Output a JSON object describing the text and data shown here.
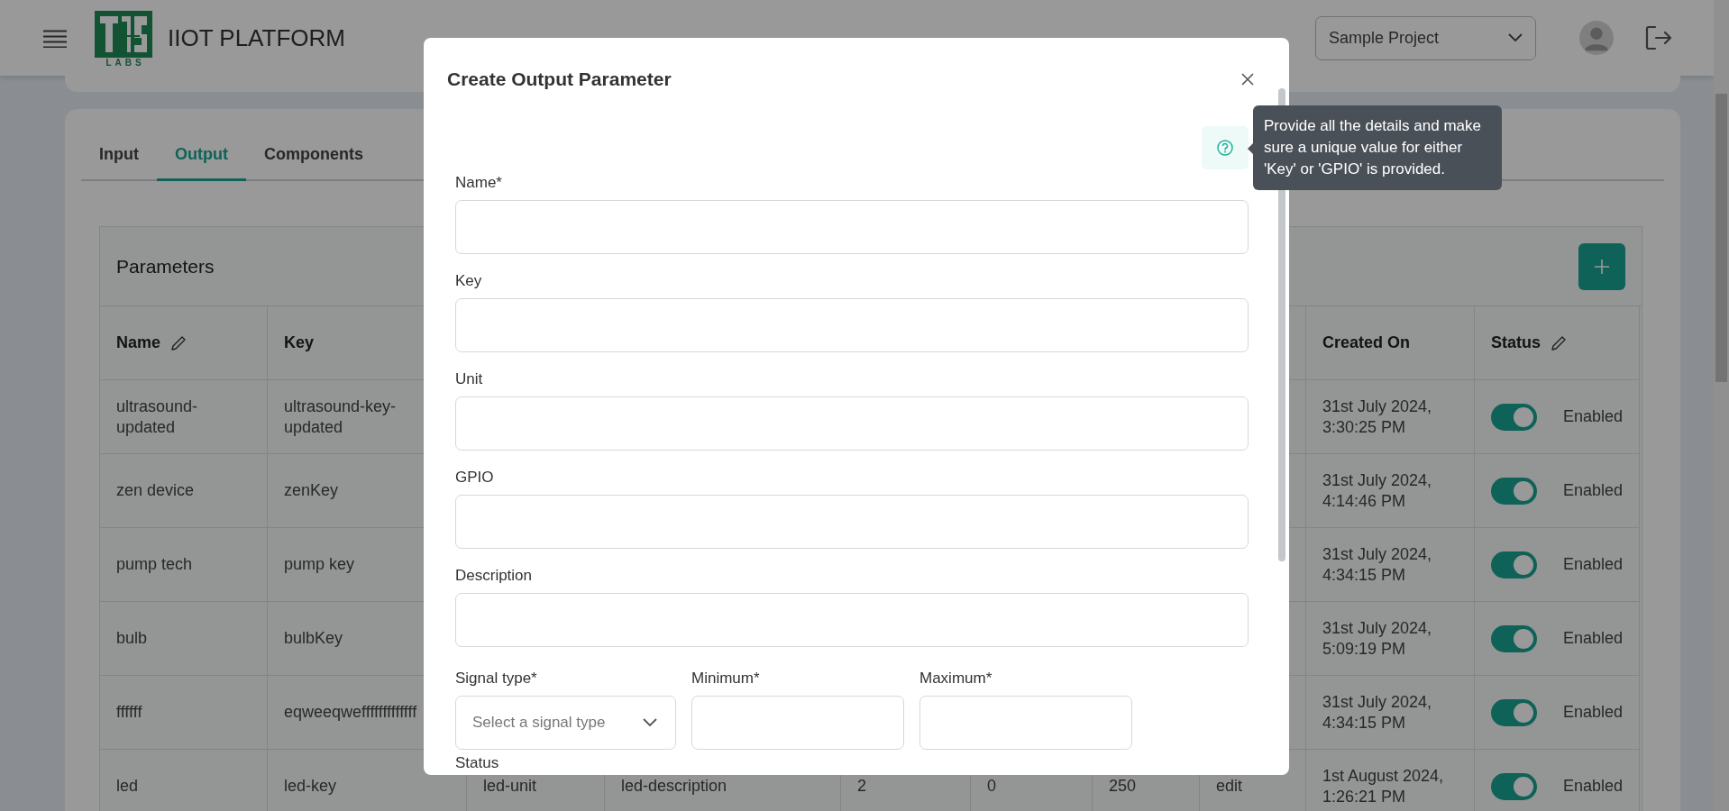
{
  "header": {
    "title": "IIOT PLATFORM",
    "logo_caption": "LABS",
    "project_select": {
      "value": "Sample Project"
    }
  },
  "tabs": [
    {
      "label": "Input",
      "selected": false
    },
    {
      "label": "Output",
      "selected": true
    },
    {
      "label": "Components",
      "selected": false
    }
  ],
  "parameters": {
    "title": "Parameters",
    "columns": [
      {
        "label": "Name",
        "editable": true
      },
      {
        "label": "Key",
        "editable": false
      },
      {
        "label": "Created On",
        "editable": false
      },
      {
        "label": "Status",
        "editable": true
      }
    ],
    "rows": [
      {
        "name": "ultrasound-updated",
        "key": "ultrasound-key-updated",
        "created_on": "31st July 2024, 3:30:25 PM",
        "status": {
          "on": true,
          "label": "Enabled"
        }
      },
      {
        "name": "zen device",
        "key": "zenKey",
        "created_on": "31st July 2024, 4:14:46 PM",
        "status": {
          "on": true,
          "label": "Enabled"
        }
      },
      {
        "name": "pump tech",
        "key": "pump key",
        "created_on": "31st July 2024, 4:34:15 PM",
        "status": {
          "on": true,
          "label": "Enabled"
        }
      },
      {
        "name": "bulb",
        "key": "bulbKey",
        "created_on": "31st July 2024, 5:09:19 PM",
        "status": {
          "on": true,
          "label": "Enabled"
        }
      },
      {
        "name": "ffffff",
        "key": "eqweeqwefffffffffffff",
        "created_on": "31st July 2024, 4:34:15 PM",
        "status": {
          "on": true,
          "label": "Enabled"
        }
      },
      {
        "name": "led",
        "key": "led-key",
        "cells": [
          "led-unit",
          "led-description",
          "2",
          "0",
          "250",
          "edit"
        ],
        "created_on": "1st August 2024, 1:26:21 PM",
        "status": {
          "on": true,
          "label": "Enabled"
        }
      }
    ]
  },
  "dialog": {
    "title": "Create Output Parameter",
    "help_tooltip": "Provide all the details and make sure a unique value for either 'Key' or 'GPIO' is provided.",
    "fields": [
      {
        "label": "Name*",
        "kind": "text"
      },
      {
        "label": "Key",
        "kind": "text"
      },
      {
        "label": "Unit",
        "kind": "text"
      },
      {
        "label": "GPIO",
        "kind": "text"
      },
      {
        "label": "Description",
        "kind": "text"
      }
    ],
    "row_fields": [
      {
        "label": "Signal type*",
        "kind": "select",
        "placeholder": "Select a signal type"
      },
      {
        "label": "Minimum*",
        "kind": "text"
      },
      {
        "label": "Maximum*",
        "kind": "text"
      }
    ],
    "status_label": "Status"
  }
}
